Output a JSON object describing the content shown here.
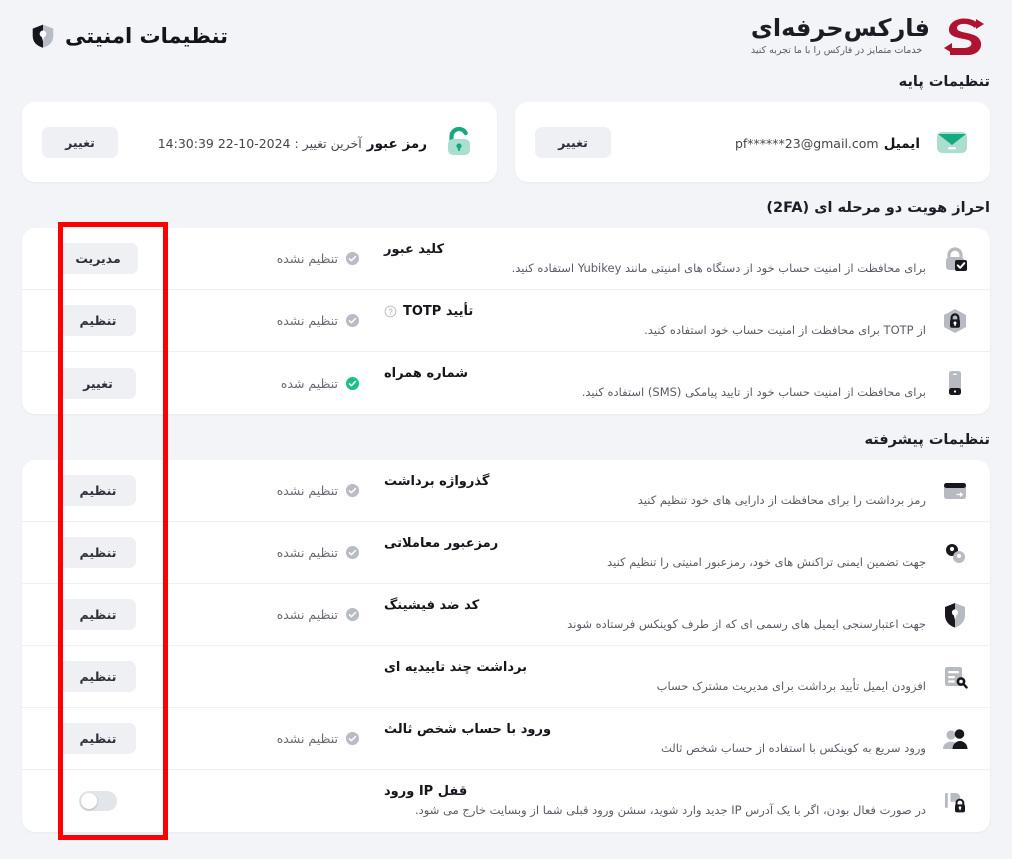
{
  "brand": {
    "title": "فارکس‌حرفه‌ای",
    "subtitle": "خدمات متمایز در فارکس را با ما تجربه کنید",
    "mark_icon": "s-swoosh-logo",
    "mark_color": "#b01232"
  },
  "header": {
    "title": "تنظیمات امنیتی",
    "icon": "shield-security-icon"
  },
  "sections": {
    "basic_title": "تنظیمات پایه",
    "twofa_title": "احراز هویت دو مرحله ای (2FA)",
    "advanced_title": "تنظیمات پیشرفته"
  },
  "basic": [
    {
      "id": "password",
      "icon": "unlocked-padlock-icon",
      "label": "رمز عبور",
      "value": "آخرین تغییر : 2024-10-22 14:30:39",
      "action": "تغییر"
    },
    {
      "id": "email",
      "icon": "envelope-icon",
      "label": "ایمیل",
      "value": "pf******23@gmail.com",
      "action": "تغییر"
    }
  ],
  "twofa_rows": [
    {
      "id": "passkey",
      "icon": "padlock-check-icon",
      "name": "کلید عبور",
      "desc": "برای محافظت از امنیت حساب خود از دستگاه های امنیتی مانند Yubikey استفاده کنید.",
      "status": "تنظیم نشده",
      "status_state": "off",
      "action": "مدیریت",
      "help": false
    },
    {
      "id": "totp",
      "icon": "hexagon-lock-icon",
      "name": "تأیید TOTP",
      "desc": "از TOTP برای محافظت از امنیت حساب خود استفاده کنید.",
      "status": "تنظیم نشده",
      "status_state": "off",
      "action": "تنظیم",
      "help": true
    },
    {
      "id": "phone",
      "icon": "mobile-phone-icon",
      "name": "شماره همراه",
      "desc": "برای محافظت از امنیت حساب خود از تایید پیامکی (SMS) استفاده کنید.",
      "status": "تنظیم شده",
      "status_state": "on",
      "action": "تغییر",
      "help": false
    }
  ],
  "advanced_rows": [
    {
      "id": "withdraw-password",
      "icon": "card-icon",
      "name": "گذرواژه برداشت",
      "desc": "رمز برداشت را برای محافظت از دارایی های خود تنظیم کنید",
      "status": "تنظیم نشده",
      "status_state": "off",
      "action": "تنظیم",
      "help": false
    },
    {
      "id": "trading-password",
      "icon": "keys-icon",
      "name": "رمزعبور معاملاتی",
      "desc": "جهت تضمین ایمنی تراکنش های خود، رمزعبور امنیتی را تنظیم کنید",
      "status": "تنظیم نشده",
      "status_state": "off",
      "action": "تنظیم",
      "help": false
    },
    {
      "id": "anti-phishing",
      "icon": "shield-phishing-icon",
      "name": "کد ضد فیشینگ",
      "desc": "جهت اعتبارسنجی ایمیل های رسمی ای که از طرف کوینکس فرستاده شوند",
      "status": "تنظیم نشده",
      "status_state": "off",
      "action": "تنظیم",
      "help": false
    },
    {
      "id": "multi-approval-withdraw",
      "icon": "document-search-icon",
      "name": "برداشت چند تاییدیه ای",
      "desc": "افزودن ایمیل تأیید برداشت برای مدیریت مشترک حساب",
      "status": "",
      "status_state": "none",
      "action": "تنظیم",
      "help": false
    },
    {
      "id": "third-party-login",
      "icon": "users-icon",
      "name": "ورود با حساب شخص ثالث",
      "desc": "ورود سریع به کوینکس با استفاده از حساب شخص ثالث",
      "status": "تنظیم نشده",
      "status_state": "off",
      "action": "تنظیم",
      "help": false
    },
    {
      "id": "ip-login-lock",
      "icon": "ip-lock-icon",
      "name": "قفل IP ورود",
      "desc": "در صورت فعال بودن، اگر با یک آدرس IP جدید وارد شوید، سشن ورود قبلی شما از وبسایت خارج می شود.",
      "status": "",
      "status_state": "none",
      "action": "",
      "toggle": "off",
      "help": false
    }
  ],
  "annotation": {
    "type": "red-highlight-rectangle",
    "color": "#ff0000"
  },
  "colors": {
    "page_background": "#f2f4f8",
    "card_background": "#ffffff",
    "accent_green": "#1cbf8c",
    "muted_grey": "#b9bcc4",
    "button_background": "#eef0f4"
  }
}
